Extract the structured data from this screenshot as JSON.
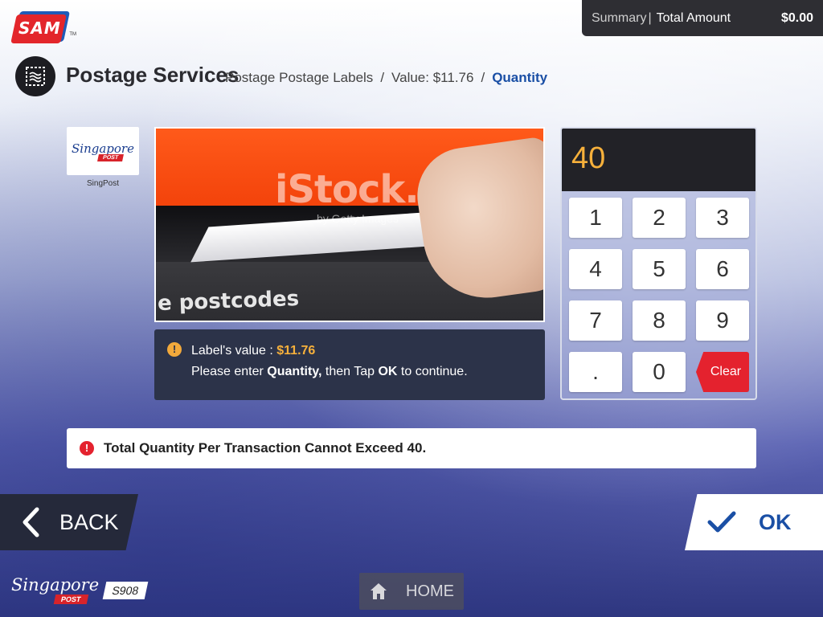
{
  "brand": {
    "sam_logo": "SAM",
    "sam_tm": "TM"
  },
  "summary": {
    "label": "Summary",
    "separator": "|",
    "total_label": "Total Amount",
    "total_value": "$0.00"
  },
  "header": {
    "title": "Postage Services",
    "breadcrumbs": [
      "Postage Postage Labels",
      "Value: $11.76",
      "Quantity"
    ],
    "divider": "/"
  },
  "provider": {
    "logo_script": "Singapore",
    "logo_post": "POST",
    "name": "SingPost"
  },
  "product_image": {
    "watermark": "iStock.",
    "watermark_sub": "by Getty Images",
    "caption": "e postcodes"
  },
  "info": {
    "label_prefix": "Label's value :",
    "label_value": "$11.76",
    "line2_start": "Please enter",
    "line2_bold1": "Quantity,",
    "line2_mid": "then Tap",
    "line2_bold2": "OK",
    "line2_end": "to continue."
  },
  "keypad": {
    "display_value": "40",
    "keys": [
      "1",
      "2",
      "3",
      "4",
      "5",
      "6",
      "7",
      "8",
      "9",
      ".",
      "0"
    ],
    "clear_label": "Clear"
  },
  "error": {
    "message": "Total Quantity Per Transaction Cannot Exceed 40."
  },
  "nav": {
    "back_label": "BACK",
    "ok_label": "OK",
    "home_label": "HOME"
  },
  "footer": {
    "logo_script": "Singapore",
    "logo_post": "POST",
    "kiosk_id": "S908"
  },
  "colors": {
    "accent_blue": "#1a4fa5",
    "warning_orange": "#f6b03b",
    "error_red": "#e4222e",
    "dark_panel": "#2c3349"
  }
}
